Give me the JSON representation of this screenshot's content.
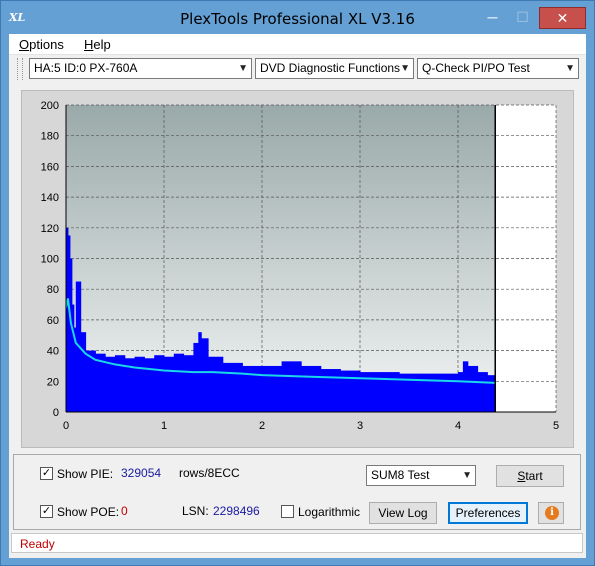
{
  "window": {
    "title": "PlexTools Professional XL V3.16",
    "icon_text": "XL"
  },
  "menu": [
    {
      "label": "Options",
      "mnemonic": "O",
      "rest": "ptions"
    },
    {
      "label": "Help",
      "mnemonic": "H",
      "rest": "elp"
    }
  ],
  "toolbar": {
    "drive": "HA:5 ID:0  PX-760A",
    "function": "DVD Diagnostic Functions",
    "test": "Q-Check PI/PO Test"
  },
  "chart_data": {
    "type": "bar",
    "xlim": [
      0,
      5
    ],
    "ylim": [
      0,
      200
    ],
    "x_ticks": [
      "0",
      "1",
      "2",
      "3",
      "4",
      "5"
    ],
    "y_ticks": [
      "0",
      "20",
      "40",
      "60",
      "80",
      "100",
      "120",
      "140",
      "160",
      "180",
      "200"
    ],
    "end_marker_x": 4.38,
    "grid": true,
    "series": [
      {
        "type": "bar",
        "color": "#0000ff",
        "x": [
          0,
          0.02,
          0.04,
          0.06,
          0.08,
          0.1,
          0.15,
          0.2,
          0.3,
          0.4,
          0.5,
          0.6,
          0.7,
          0.8,
          0.9,
          1.0,
          1.1,
          1.2,
          1.3,
          1.35,
          1.38,
          1.45,
          1.6,
          1.8,
          2.0,
          2.2,
          2.4,
          2.6,
          2.8,
          3.0,
          3.2,
          3.4,
          3.6,
          3.8,
          4.0,
          4.05,
          4.1,
          4.2,
          4.3,
          4.38
        ],
        "y": [
          120,
          115,
          100,
          70,
          55,
          85,
          52,
          40,
          38,
          36,
          37,
          35,
          36,
          35,
          37,
          36,
          38,
          37,
          45,
          52,
          48,
          36,
          32,
          30,
          30,
          33,
          30,
          28,
          27,
          26,
          26,
          25,
          25,
          25,
          26,
          33,
          30,
          26,
          24,
          22
        ]
      },
      {
        "type": "line",
        "color": "#19d7e8",
        "x": [
          0,
          0.02,
          0.05,
          0.1,
          0.2,
          0.3,
          0.5,
          0.7,
          1.0,
          1.3,
          1.5,
          1.8,
          2.0,
          2.5,
          3.0,
          3.5,
          4.0,
          4.38
        ],
        "y": [
          68,
          74,
          58,
          45,
          38,
          34,
          31,
          29,
          27,
          26,
          26,
          25,
          24,
          23,
          22,
          21,
          20,
          19
        ]
      }
    ]
  },
  "stats": {
    "show_pie_label": "Show PIE:",
    "pie_value": "329054",
    "rows_label": "rows/8ECC",
    "show_poe_label": "Show POE:",
    "poe_value": "0",
    "lsn_label": "LSN:",
    "lsn_value": "2298496",
    "log_label": "Logarithmic",
    "test_select": "SUM8 Test"
  },
  "buttons": {
    "start": "Start",
    "view_log": "View Log",
    "preferences": "Preferences"
  },
  "status": {
    "text": "Ready"
  },
  "colors": {
    "pie_bar": "#0000ff",
    "avg_line": "#19d7e8",
    "status": "#c00000"
  }
}
